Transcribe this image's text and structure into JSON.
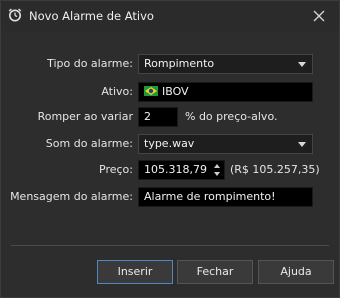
{
  "window": {
    "title": "Novo Alarme de Ativo",
    "icon": "alarm-clock-icon",
    "close_icon": "close-icon"
  },
  "form": {
    "alarm_type": {
      "label": "Tipo do alarme:",
      "value": "Rompimento"
    },
    "asset": {
      "label": "Ativo:",
      "value": "IBOV",
      "flag_icon": "brazil-flag-icon"
    },
    "break_variation": {
      "label": "Romper ao variar",
      "value": "2",
      "suffix": "% do preço-alvo."
    },
    "sound": {
      "label": "Som do alarme:",
      "value": "type.wav"
    },
    "price": {
      "label": "Preço:",
      "value": "105.318,79",
      "reference": "(R$ 105.257,35)"
    },
    "message": {
      "label": "Mensagem do alarme:",
      "value": "Alarme de rompimento!"
    }
  },
  "buttons": {
    "insert": "Inserir",
    "close": "Fechar",
    "help": "Ajuda"
  },
  "colors": {
    "background": "#2d2d2d",
    "field_bg": "#000000",
    "default_button_border": "#4f86c6"
  }
}
